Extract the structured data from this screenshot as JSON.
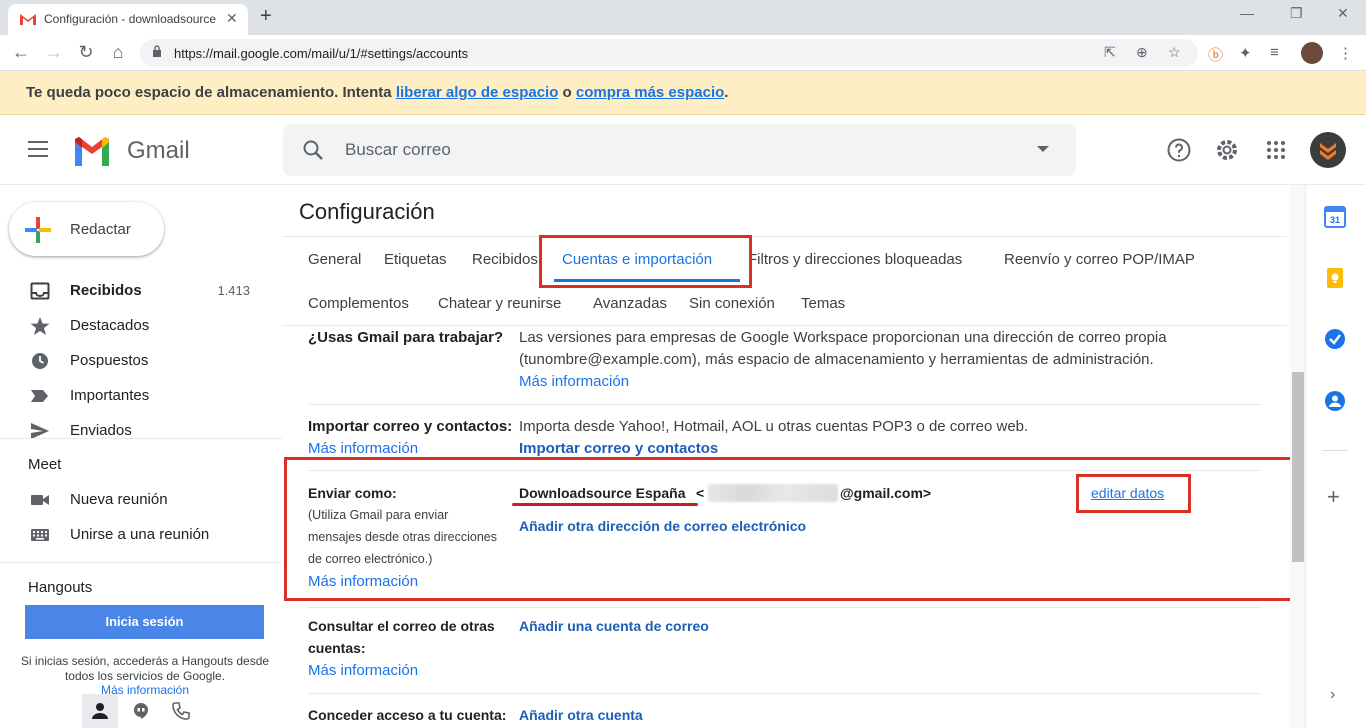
{
  "browser": {
    "tab_title": "Configuración - downloadsource",
    "url": "https://mail.google.com/mail/u/1/#settings/accounts"
  },
  "banner": {
    "text_before": "Te queda poco espacio de almacenamiento. Intenta ",
    "link1": "liberar algo de espacio",
    "text_mid": " o ",
    "link2": "compra más espacio",
    "text_end": "."
  },
  "header": {
    "app_name": "Gmail",
    "search_placeholder": "Buscar correo"
  },
  "compose": {
    "label": "Redactar"
  },
  "nav": {
    "items": [
      {
        "label": "Recibidos",
        "count": "1.413",
        "icon": "inbox-icon"
      },
      {
        "label": "Destacados",
        "icon": "star-icon"
      },
      {
        "label": "Pospuestos",
        "icon": "clock-icon"
      },
      {
        "label": "Importantes",
        "icon": "label-important-icon"
      },
      {
        "label": "Enviados",
        "icon": "send-icon"
      }
    ],
    "meet_title": "Meet",
    "meet_items": [
      {
        "label": "Nueva reunión",
        "icon": "video-icon"
      },
      {
        "label": "Unirse a una reunión",
        "icon": "keyboard-icon"
      }
    ],
    "hangouts_title": "Hangouts",
    "hangouts_button": "Inicia sesión",
    "hangouts_text": "Si inicias sesión, accederás a Hangouts desde todos los servicios de Google.",
    "hangouts_more": "Más información"
  },
  "settings": {
    "title": "Configuración",
    "tabs_row1": [
      "General",
      "Etiquetas",
      "Recibidos",
      "Cuentas e importación",
      "Filtros y direcciones bloqueadas",
      "Reenvío y correo POP/IMAP"
    ],
    "tabs_row2": [
      "Complementos",
      "Chatear y reunirse",
      "Avanzadas",
      "Sin conexión",
      "Temas"
    ],
    "active_tab": "Cuentas e importación",
    "rows": {
      "work": {
        "heading": "¿Usas Gmail para trabajar?",
        "line1": "Las versiones para empresas de Google Workspace proporcionan una dirección de correo propia",
        "line2": "(tunombre@example.com), más espacio de almacenamiento y herramientas de administración.",
        "link": "Más información"
      },
      "import": {
        "heading": "Importar correo y contactos:",
        "more": "Más información",
        "text": "Importa desde Yahoo!, Hotmail, AOL u otras cuentas POP3 o de correo web.",
        "link": "Importar correo y contactos"
      },
      "sendas": {
        "heading": "Enviar como:",
        "desc1": "(Utiliza Gmail para enviar",
        "desc2": "mensajes desde otras direcciones",
        "desc3": "de correo electrónico.)",
        "more": "Más información",
        "name": "Downloadsource España",
        "addr_open": "<",
        "addr_end": "@gmail.com>",
        "edit": "editar datos",
        "add": "Añadir otra dirección de correo electrónico"
      },
      "check": {
        "heading1": "Consultar el correo de otras",
        "heading2": "cuentas:",
        "more": "Más información",
        "link": "Añadir una cuenta de correo"
      },
      "grant": {
        "heading": "Conceder acceso a tu cuenta:",
        "link": "Añadir otra cuenta"
      }
    }
  },
  "colors": {
    "accent": "#1a73e8",
    "highlight": "#d93025",
    "banner": "#fdefc3",
    "hangouts_button": "#4a86e8"
  }
}
